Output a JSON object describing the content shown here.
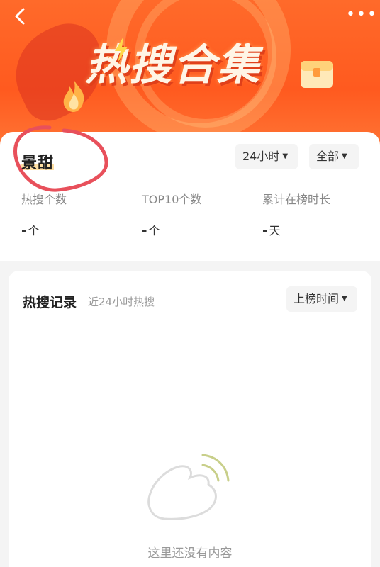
{
  "banner": {
    "title": "热搜合集",
    "back_icon": "back-chevron-icon",
    "more_icon": "more-dots-icon",
    "more_text": "•••"
  },
  "stats": {
    "keyword": "景甜",
    "time_filter": "24小时",
    "scope_filter": "全部",
    "items": [
      {
        "label": "热搜个数",
        "value": "-",
        "unit": "个"
      },
      {
        "label": "TOP10个数",
        "value": "-",
        "unit": "个"
      },
      {
        "label": "累计在榜时长",
        "value": "-",
        "unit": "天"
      }
    ]
  },
  "records": {
    "title": "热搜记录",
    "subtitle": "近24小时热搜",
    "sort_label": "上榜时间",
    "empty_text": "这里还没有内容"
  },
  "colors": {
    "banner_orange": "#ff5a1f",
    "annotation_red": "#e8505b",
    "text_dark": "#222222",
    "text_muted": "#888888"
  }
}
